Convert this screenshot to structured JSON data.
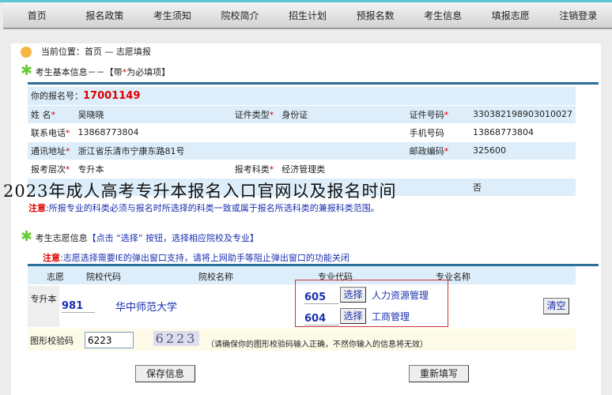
{
  "nav": [
    "首页",
    "报名政策",
    "考生须知",
    "院校简介",
    "招生计划",
    "预报名数",
    "考生信息",
    "填报志愿",
    "注销登录"
  ],
  "location": "当前位置：首页 — 志愿填报",
  "basic_title": "考生基本信息－－【带",
  "basic_title_star": "*",
  "basic_title_end": "为必填项】",
  "reg_label": "你的报名号：",
  "reg_no": "17001149",
  "rows": [
    [
      {
        "l": "姓 名",
        "r": true,
        "v": "吴晓晓"
      },
      {
        "l": "证件类型",
        "r": true,
        "v": "身份证"
      },
      {
        "l": "证件号码",
        "r": true,
        "v": "330382198903010027"
      }
    ],
    [
      {
        "l": "联系电话",
        "r": true,
        "v": "13868773804"
      },
      {
        "l": "",
        "r": false,
        "v": ""
      },
      {
        "l": "手机号码",
        "r": false,
        "v": "13868773804"
      }
    ],
    [
      {
        "l": "通讯地址",
        "r": true,
        "v": "浙江省乐清市宁康东路81号"
      },
      {
        "l": "",
        "r": false,
        "v": ""
      },
      {
        "l": "邮政编码",
        "r": true,
        "v": "325600"
      }
    ],
    [
      {
        "l": "报考层次",
        "r": true,
        "v": "专升本"
      },
      {
        "l": "报考科类",
        "r": true,
        "v": "经济管理类"
      },
      {
        "l": "",
        "r": false,
        "v": ""
      }
    ],
    [
      {
        "l": "",
        "r": false,
        "v": ""
      },
      {
        "l": "",
        "r": false,
        "v": ""
      },
      {
        "l": "",
        "r": false,
        "v": "否"
      }
    ]
  ],
  "note1_lead": "注意",
  "note1": ":所报专业的科类必须与报名时所选择的科类一致或属于报名所选科类的兼报科类范围。",
  "wish_title": "考生志愿信息",
  "wish_hint": "【点击 “选择” 按钮，选择相应院校及专业】",
  "note2_lead": "注意",
  "note2": ":志愿选择需要IE的弹出窗口支持，请将上网助手等阻止弹出窗口的功能关闭",
  "headers": [
    "志愿",
    "院校代码",
    "院校名称",
    "专业代码",
    "专业名称"
  ],
  "level": "专升本",
  "school_code": "981",
  "school_name": "华中师范大学",
  "majors": [
    {
      "code": "605",
      "name": "人力资源管理"
    },
    {
      "code": "604",
      "name": "工商管理"
    }
  ],
  "choose_label": "选择",
  "clear_label": "清空",
  "captcha_label": "图形校验码",
  "captcha_value": "6223",
  "captcha_image": "6223",
  "captcha_hint": "（请确保你的图形校验码输入正确，不然你输入的信息将无效）",
  "save_label": "保存信息",
  "reset_label": "重新填写",
  "overlay_title": "2023年成人高考专升本报名入口官网以及报名时间"
}
